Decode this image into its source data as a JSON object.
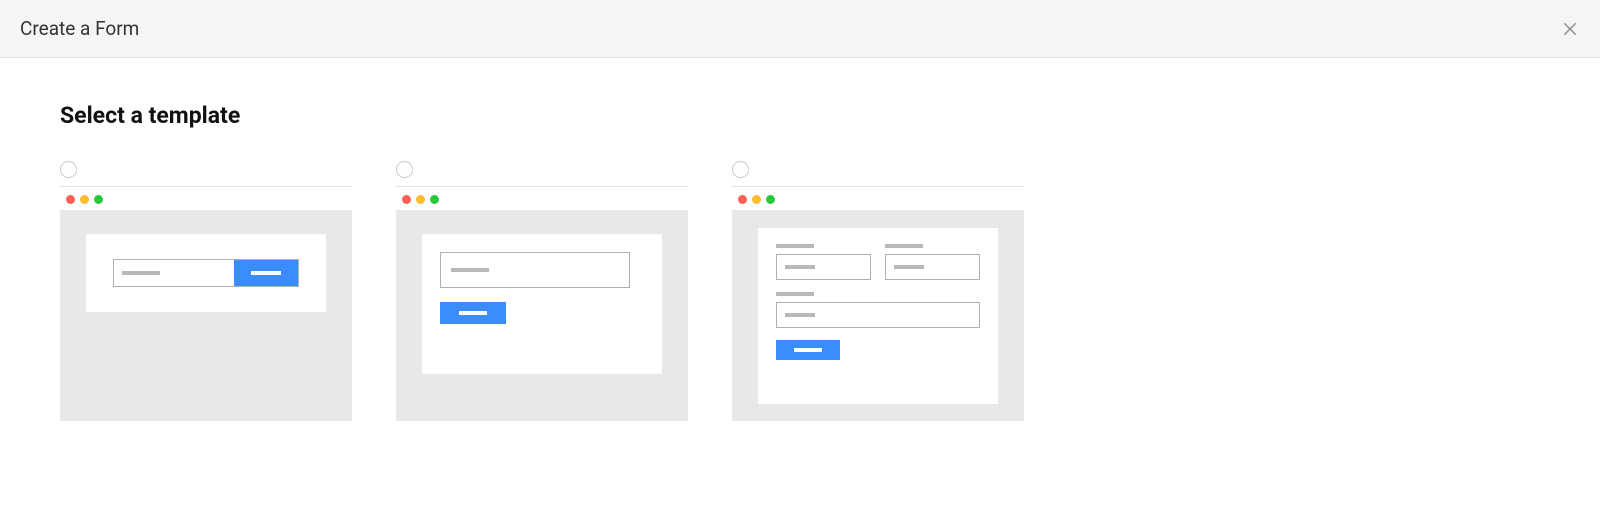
{
  "header": {
    "title": "Create a Form"
  },
  "section": {
    "title": "Select a template"
  },
  "templates": [
    {
      "id": "inline"
    },
    {
      "id": "stacked-single"
    },
    {
      "id": "multi-field"
    }
  ],
  "colors": {
    "accent": "#3b8cff",
    "canvas": "#e8e8e8",
    "chrome_red": "#ff5f56",
    "chrome_yellow": "#ffbd2e",
    "chrome_green": "#27c93f"
  }
}
